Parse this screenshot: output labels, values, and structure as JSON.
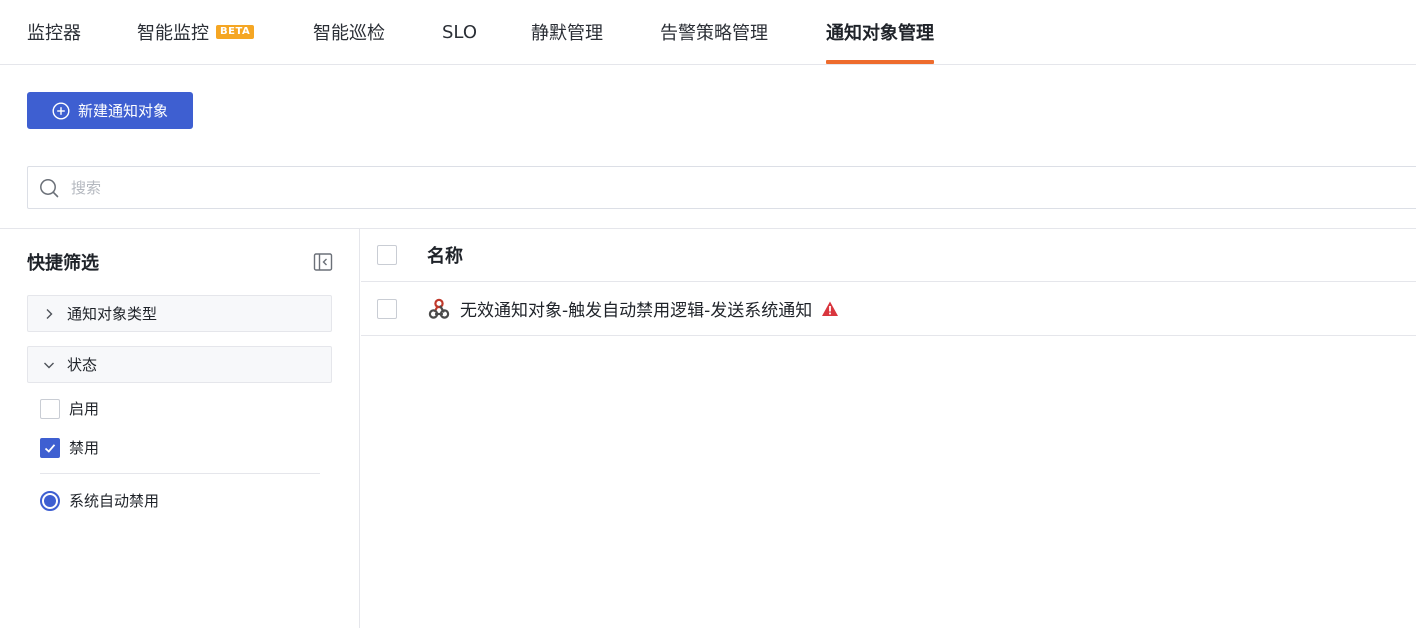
{
  "tabs": [
    {
      "label": "监控器"
    },
    {
      "label": "智能监控",
      "badge": "BETA"
    },
    {
      "label": "智能巡检"
    },
    {
      "label": "SLO"
    },
    {
      "label": "静默管理"
    },
    {
      "label": "告警策略管理"
    },
    {
      "label": "通知对象管理",
      "active": true
    }
  ],
  "toolbar": {
    "create_label": "新建通知对象",
    "create_icon": "plus-circle-icon"
  },
  "search": {
    "placeholder": "搜索",
    "value": "",
    "icon": "search-icon"
  },
  "sidebar": {
    "title": "快捷筛选",
    "collapse_icon": "collapse-panel-icon",
    "groups": [
      {
        "label": "通知对象类型",
        "expanded": false
      },
      {
        "label": "状态",
        "expanded": true
      }
    ],
    "status_options": [
      {
        "label": "启用",
        "checked": false
      },
      {
        "label": "禁用",
        "checked": true
      }
    ],
    "sub_option": {
      "label": "系统自动禁用",
      "selected": true
    }
  },
  "table": {
    "columns": [
      "名称"
    ],
    "rows": [
      {
        "name": "无效通知对象-触发自动禁用逻辑-发送系统通知",
        "icon": "webhook-icon",
        "status_icon": "warning-icon"
      }
    ]
  },
  "colors": {
    "accent": "#3e5fd1",
    "tab_indicator": "#ee6c2d",
    "beta_badge": "#f5a623",
    "warning": "#d9363e"
  }
}
